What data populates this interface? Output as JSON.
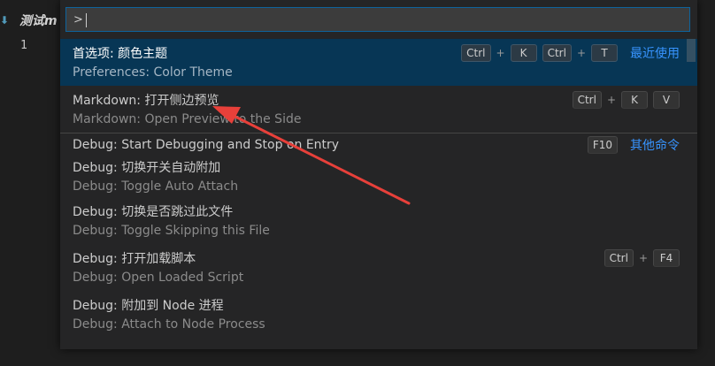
{
  "editor": {
    "tab_title": "测试m",
    "tab_icon": "markdown-file-icon",
    "line_number": "1"
  },
  "command_palette": {
    "input_value": ">",
    "items": [
      {
        "label": "首选项: 颜色主题",
        "detail": "Preferences: Color Theme",
        "keybinding": [
          "Ctrl",
          "K",
          "Ctrl",
          "T"
        ],
        "group": "最近使用",
        "selected": true
      },
      {
        "label": "Markdown: 打开侧边预览",
        "detail": "Markdown: Open Preview to the Side",
        "keybinding": [
          "Ctrl",
          "K",
          "V"
        ]
      },
      {
        "label": "Debug: Start Debugging and Stop on Entry",
        "keybinding": [
          "F10"
        ],
        "group": "其他命令"
      },
      {
        "label": "Debug: 切换开关自动附加",
        "detail": "Debug: Toggle Auto Attach"
      },
      {
        "label": "Debug: 切换是否跳过此文件",
        "detail": "Debug: Toggle Skipping this File"
      },
      {
        "label": "Debug: 打开加载脚本",
        "detail": "Debug: Open Loaded Script",
        "keybinding": [
          "Ctrl",
          "F4"
        ]
      },
      {
        "label": "Debug: 附加到 Node 进程",
        "detail": "Debug: Attach to Node Process"
      }
    ],
    "plus": "+"
  },
  "colors": {
    "selection_bg": "#073655",
    "accent_blue": "#3794ff",
    "annotation_red": "#e8403a"
  }
}
